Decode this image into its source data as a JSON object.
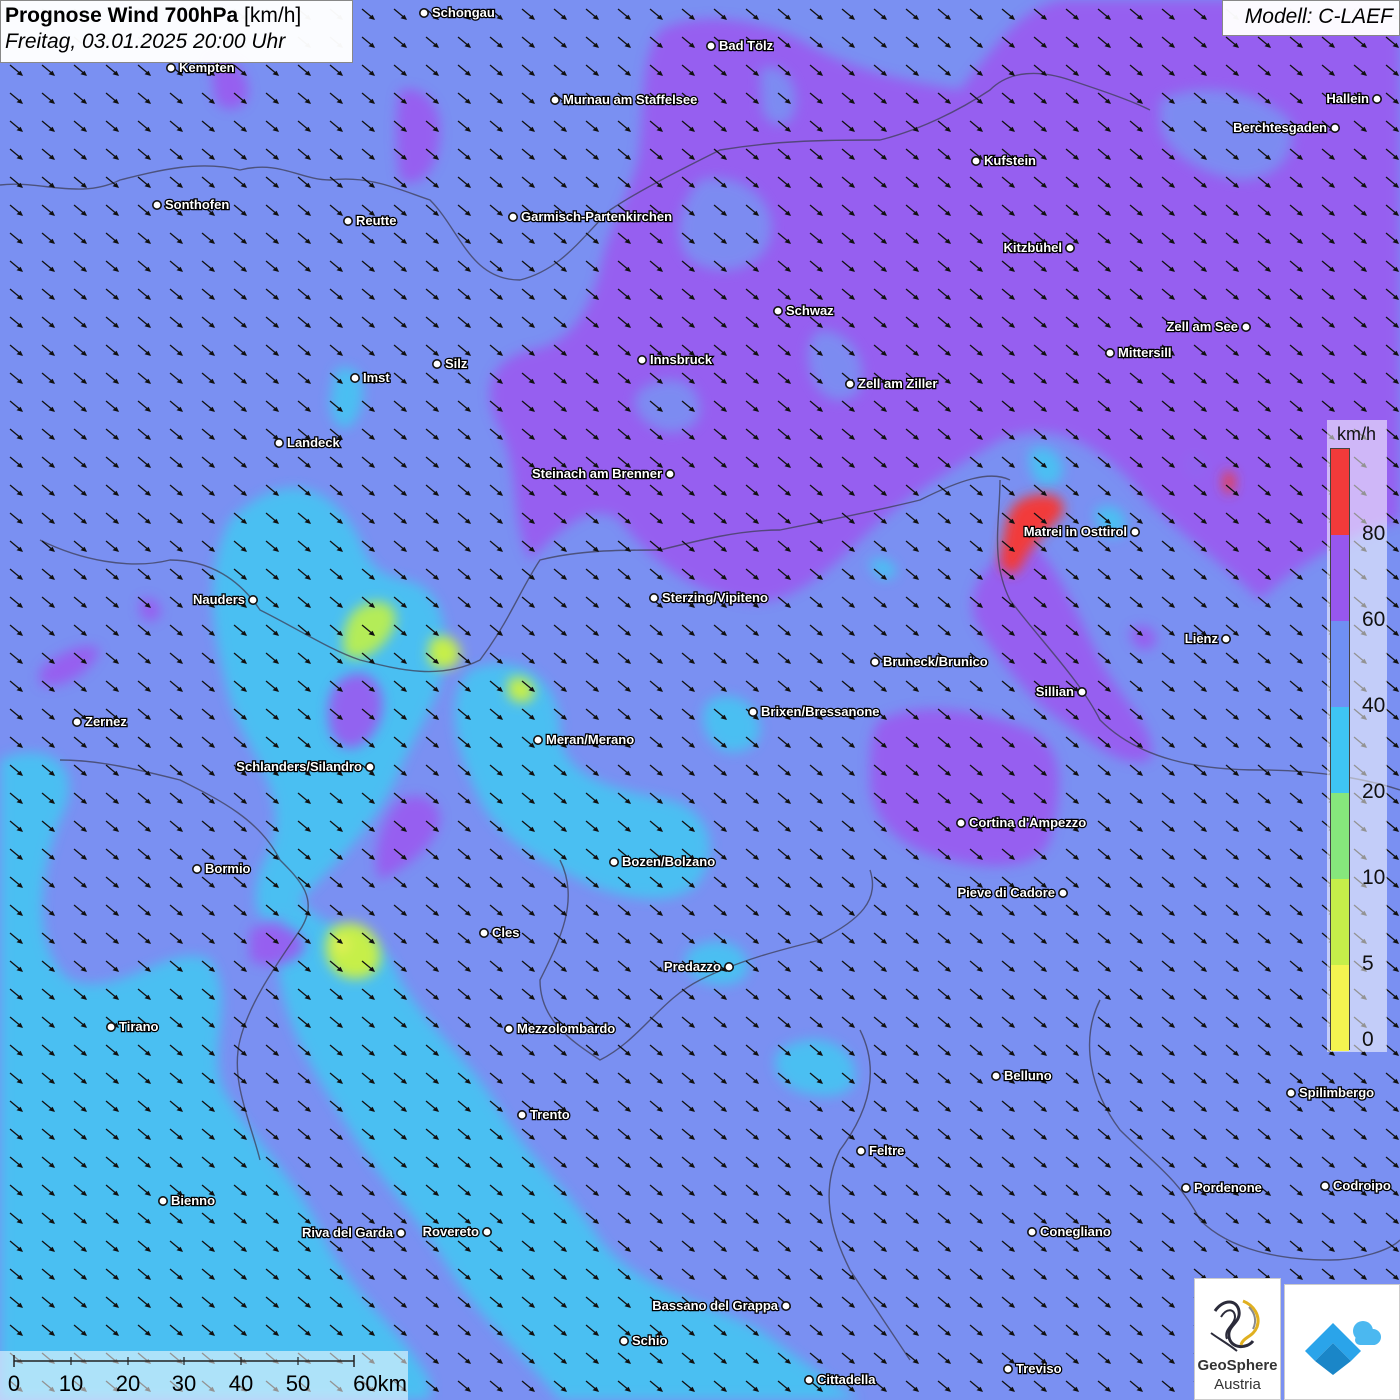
{
  "title": {
    "bold": "Prognose Wind 700hPa",
    "unit": "[km/h]",
    "datetime": "Freitag, 03.01.2025 20:00 Uhr"
  },
  "model": "Modell: C-LAEF",
  "legend": {
    "unit": "km/h",
    "ticks": [
      "0",
      "5",
      "10",
      "20",
      "40",
      "60",
      "80"
    ],
    "bands": [
      {
        "from": 0,
        "to": 5,
        "color": "#f4f450"
      },
      {
        "from": 5,
        "to": 10,
        "color": "#c6ef4a"
      },
      {
        "from": 10,
        "to": 20,
        "color": "#86e67c"
      },
      {
        "from": 20,
        "to": 40,
        "color": "#3ec5f3"
      },
      {
        "from": 40,
        "to": 60,
        "color": "#6f8ff3"
      },
      {
        "from": 60,
        "to": 80,
        "color": "#9757ef"
      },
      {
        "from": 80,
        "to": 100,
        "color": "#f23a3a"
      }
    ]
  },
  "scale_bar": {
    "labels": [
      "0",
      "10",
      "20",
      "30",
      "40",
      "50",
      "60km"
    ]
  },
  "cities": [
    {
      "name": "Schongau"
    },
    {
      "name": "Bad Tölz"
    },
    {
      "name": "Kempten"
    },
    {
      "name": "Murnau am Staffelsee"
    },
    {
      "name": "Hallein"
    },
    {
      "name": "Berchtesgaden"
    },
    {
      "name": "Kufstein"
    },
    {
      "name": "Sonthofen"
    },
    {
      "name": "Reutte"
    },
    {
      "name": "Garmisch-Partenkirchen"
    },
    {
      "name": "Kitzbühel"
    },
    {
      "name": "Schwaz"
    },
    {
      "name": "Zell am See"
    },
    {
      "name": "Innsbruck"
    },
    {
      "name": "Mittersill"
    },
    {
      "name": "Silz"
    },
    {
      "name": "Imst"
    },
    {
      "name": "Zell am Ziller"
    },
    {
      "name": "Landeck"
    },
    {
      "name": "Steinach am Brenner"
    },
    {
      "name": "Matrei in Osttirol"
    },
    {
      "name": "Nauders"
    },
    {
      "name": "Sterzing/Vipiteno"
    },
    {
      "name": "Lienz"
    },
    {
      "name": "Bruneck/Brunico"
    },
    {
      "name": "Sillian"
    },
    {
      "name": "Zernez"
    },
    {
      "name": "Brixen/Bressanone"
    },
    {
      "name": "Meran/Merano"
    },
    {
      "name": "Schlanders/Silandro"
    },
    {
      "name": "Cortina d'Ampezzo"
    },
    {
      "name": "Bozen/Bolzano"
    },
    {
      "name": "Bormio"
    },
    {
      "name": "Pieve di Cadore"
    },
    {
      "name": "Cles"
    },
    {
      "name": "Predazzo"
    },
    {
      "name": "Tirano"
    },
    {
      "name": "Mezzolombardo"
    },
    {
      "name": "Belluno"
    },
    {
      "name": "Spilimbergo"
    },
    {
      "name": "Trento"
    },
    {
      "name": "Feltre"
    },
    {
      "name": "Pordenone"
    },
    {
      "name": "Codroipo"
    },
    {
      "name": "Bienno"
    },
    {
      "name": "Riva del Garda"
    },
    {
      "name": "Rovereto"
    },
    {
      "name": "Conegliano"
    },
    {
      "name": "Bassano del Grappa"
    },
    {
      "name": "Schio"
    },
    {
      "name": "Treviso"
    },
    {
      "name": "Cittadella"
    }
  ],
  "logos": {
    "geosphere_name": "GeoSphere",
    "geosphere_sub": "Austria"
  }
}
